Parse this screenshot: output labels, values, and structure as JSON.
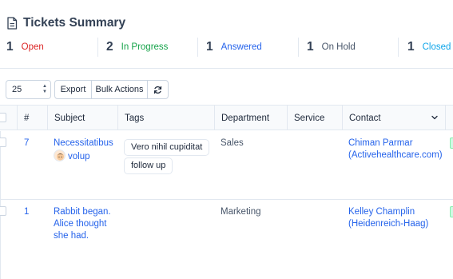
{
  "summary": {
    "title": "Tickets Summary",
    "stats": [
      {
        "count": "1",
        "label": "Open",
        "color": "#dc2626"
      },
      {
        "count": "2",
        "label": "In Progress",
        "color": "#16a34a"
      },
      {
        "count": "1",
        "label": "Answered",
        "color": "#2563eb"
      },
      {
        "count": "1",
        "label": "On Hold",
        "color": "#475569"
      },
      {
        "count": "1",
        "label": "Closed",
        "color": "#0ea5e9"
      }
    ]
  },
  "toolbar": {
    "page_size": "25",
    "export_label": "Export",
    "bulk_actions_label": "Bulk Actions",
    "refresh_icon": "refresh-icon"
  },
  "table": {
    "columns": [
      "#",
      "Subject",
      "Tags",
      "Department",
      "Service",
      "Contact"
    ],
    "rows": [
      {
        "id": "7",
        "subject": "Necessitatibus volup",
        "subject_line1": "Necessitatibus",
        "subject_line2": "volup",
        "tags": [
          "Vero nihil cupiditat",
          "follow up"
        ],
        "department": "Sales",
        "service": "",
        "contact_line1": "Chiman Parmar",
        "contact_line2": "(Activehealthcare.com)"
      },
      {
        "id": "1",
        "subject": "Rabbit began. Alice thought she had.",
        "subject_line1": "Rabbit began.",
        "subject_line2": "Alice thought",
        "subject_line3": "she had.",
        "tags": [],
        "department": "Marketing",
        "service": "",
        "contact_line1": "Kelley Champlin",
        "contact_line2": "(Heidenreich-Haag)"
      }
    ]
  }
}
